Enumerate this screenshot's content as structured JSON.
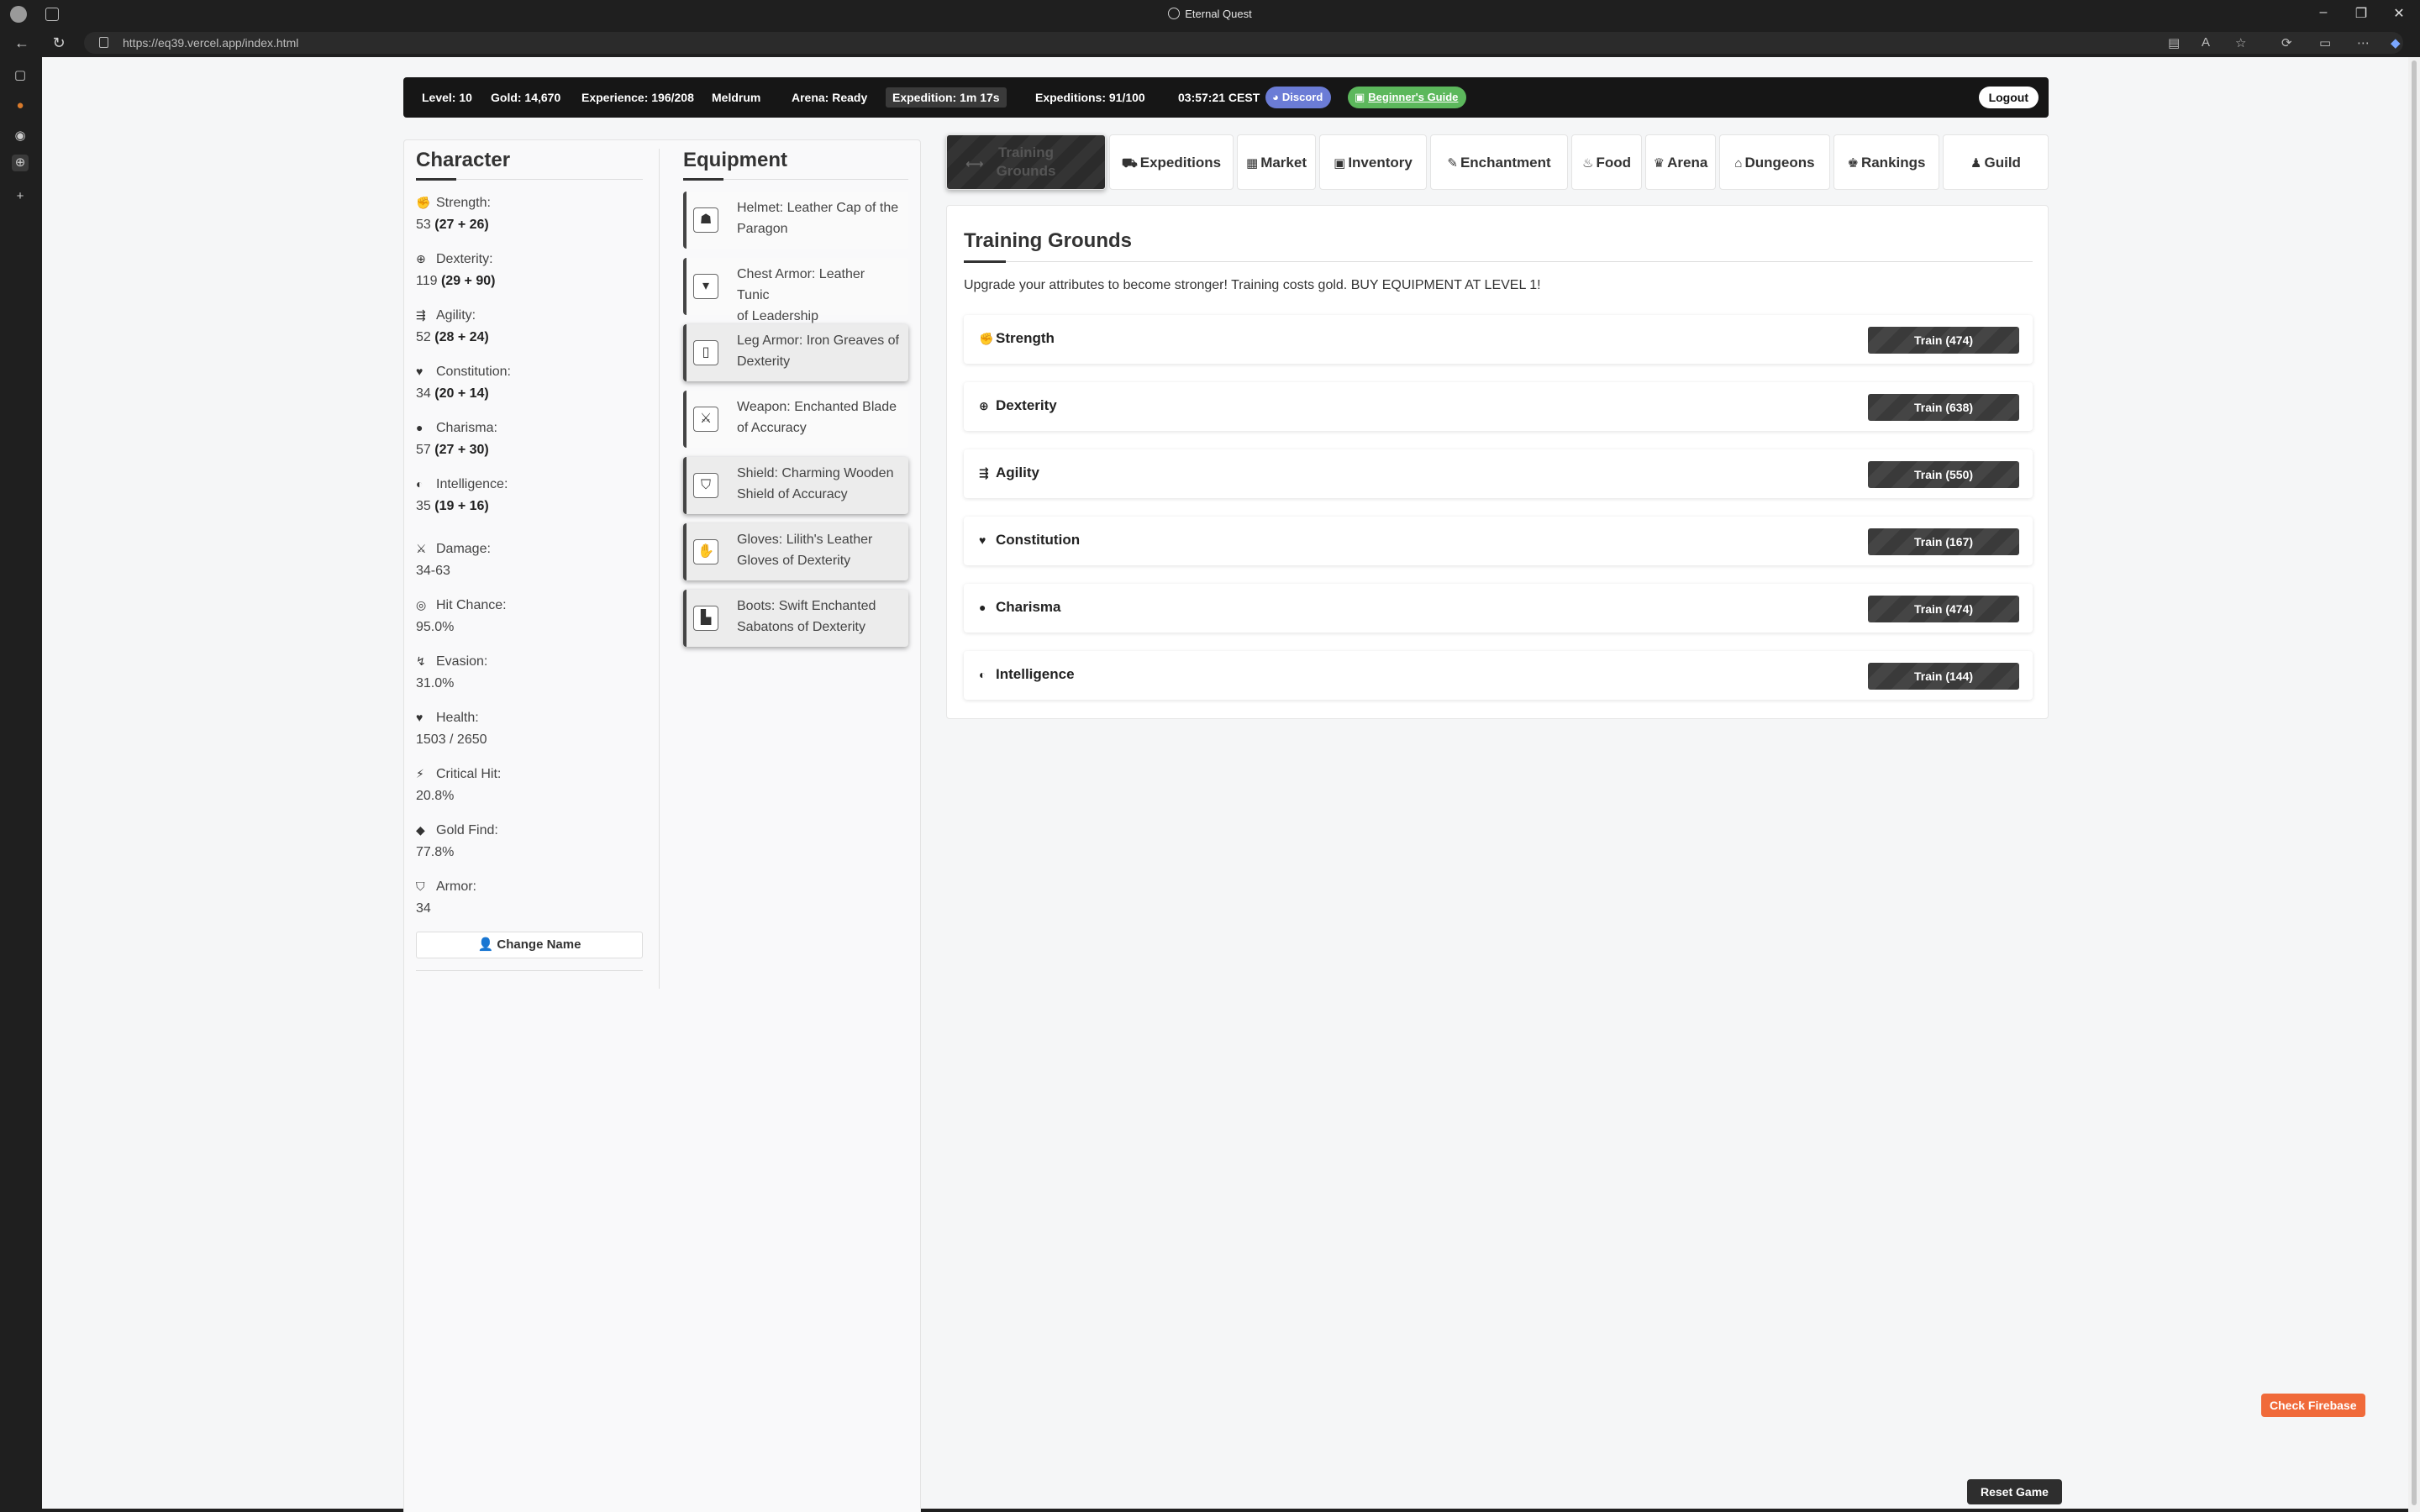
{
  "browser": {
    "window_title": "Eternal Quest",
    "url": "https://eq39.vercel.app/index.html",
    "window_controls": {
      "minimize": "–",
      "restore": "❐",
      "close": "✕"
    }
  },
  "status_bar": {
    "level": "Level: 10",
    "gold": "Gold: 14,670",
    "experience": "Experience: 196/208",
    "location": "Meldrum",
    "arena": "Arena: Ready",
    "expedition": "Expedition: 1m 17s",
    "expeditions": "Expeditions: 91/100",
    "time": "03:57:21 CEST",
    "discord": "Discord",
    "guide": "Beginner's Guide",
    "logout": "Logout"
  },
  "character": {
    "title": "Character",
    "stats": [
      {
        "label": "Strength:",
        "base": "53",
        "breakdown": "(27 + 26)",
        "icon": "fist-icon"
      },
      {
        "label": "Dexterity:",
        "base": "119",
        "breakdown": "(29 + 90)",
        "icon": "crosshair-icon"
      },
      {
        "label": "Agility:",
        "base": "52",
        "breakdown": "(28 + 24)",
        "icon": "running-icon"
      },
      {
        "label": "Constitution:",
        "base": "34",
        "breakdown": "(20 + 14)",
        "icon": "heart-pulse-icon"
      },
      {
        "label": "Charisma:",
        "base": "57",
        "breakdown": "(27 + 30)",
        "icon": "speech-icon"
      },
      {
        "label": "Intelligence:",
        "base": "35",
        "breakdown": "(19 + 16)",
        "icon": "brain-icon"
      }
    ],
    "derived": [
      {
        "label": "Damage:",
        "value": "34-63",
        "icon": "swords-icon"
      },
      {
        "label": "Hit Chance:",
        "value": "95.0%",
        "icon": "target-icon"
      },
      {
        "label": "Evasion:",
        "value": "31.0%",
        "icon": "dodge-icon"
      },
      {
        "label": "Health:",
        "value": "1503 / 2650",
        "icon": "heart-icon"
      },
      {
        "label": "Critical Hit:",
        "value": "20.8%",
        "icon": "bolt-icon"
      },
      {
        "label": "Gold Find:",
        "value": "77.8%",
        "icon": "gem-icon"
      },
      {
        "label": "Armor:",
        "value": "34",
        "icon": "shield-icon"
      }
    ],
    "change_name": "Change Name"
  },
  "equipment": {
    "title": "Equipment",
    "items": [
      {
        "line1": "Helmet: Leather Cap of the",
        "line2": "Paragon",
        "icon": "helmet-icon",
        "selected": false
      },
      {
        "line1": "Chest Armor: Leather Tunic",
        "line2": "of Leadership",
        "icon": "chest-armor-icon",
        "selected": false
      },
      {
        "line1": "Leg Armor: Iron Greaves of",
        "line2": "Dexterity",
        "icon": "leg-armor-icon",
        "selected": true
      },
      {
        "line1": "Weapon: Enchanted Blade",
        "line2": "of Accuracy",
        "icon": "sword-icon",
        "selected": false
      },
      {
        "line1": "Shield: Charming Wooden",
        "line2": "Shield of Accuracy",
        "icon": "shield-icon",
        "selected": true
      },
      {
        "line1": "Gloves: Lilith's Leather",
        "line2": "Gloves of Dexterity",
        "icon": "gloves-icon",
        "selected": true
      },
      {
        "line1": "Boots: Swift Enchanted",
        "line2": "Sabatons of Dexterity",
        "icon": "boots-icon",
        "selected": true
      }
    ]
  },
  "tabs": [
    {
      "label1": "Training",
      "label2": "Grounds",
      "icon": "dumbbell-icon",
      "active": true
    },
    {
      "label": "Expeditions",
      "icon": "map-icon"
    },
    {
      "label": "Market",
      "icon": "store-icon"
    },
    {
      "label": "Inventory",
      "icon": "box-icon"
    },
    {
      "label": "Enchantment",
      "icon": "wand-icon"
    },
    {
      "label": "Food",
      "icon": "drumstick-icon"
    },
    {
      "label": "Arena",
      "icon": "trophy-icon"
    },
    {
      "label": "Dungeons",
      "icon": "dungeon-icon"
    },
    {
      "label": "Rankings",
      "icon": "crown-icon"
    },
    {
      "label": "Guild",
      "icon": "users-icon"
    }
  ],
  "training": {
    "title": "Training Grounds",
    "description": "Upgrade your attributes to become stronger! Training costs gold. BUY EQUIPMENT AT LEVEL 1!",
    "rows": [
      {
        "name": "Strength",
        "button": "Train (474)",
        "icon": "fist-icon"
      },
      {
        "name": "Dexterity",
        "button": "Train (638)",
        "icon": "crosshair-icon"
      },
      {
        "name": "Agility",
        "button": "Train (550)",
        "icon": "running-icon"
      },
      {
        "name": "Constitution",
        "button": "Train (167)",
        "icon": "heart-pulse-icon"
      },
      {
        "name": "Charisma",
        "button": "Train (474)",
        "icon": "speech-icon"
      },
      {
        "name": "Intelligence",
        "button": "Train (144)",
        "icon": "brain-icon"
      }
    ]
  },
  "floating": {
    "check_firebase": "Check Firebase",
    "reset_game": "Reset Game"
  }
}
